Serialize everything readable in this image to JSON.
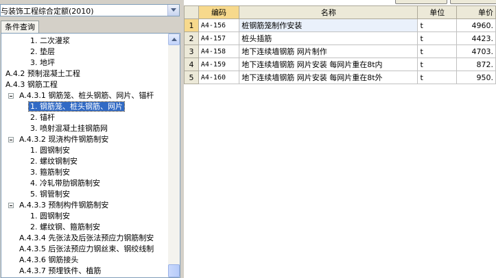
{
  "quota_selector": {
    "value": "与装饰工程综合定额(2010)"
  },
  "left_tab": {
    "label": "条件查询"
  },
  "tree": [
    {
      "label": "1. 二次灌浆",
      "level": 3
    },
    {
      "label": "2. 垫层",
      "level": 3
    },
    {
      "label": "3. 地坪",
      "level": 3
    },
    {
      "label": "A.4.2 预制混凝土工程",
      "level": 1
    },
    {
      "label": "A.4.3 钢筋工程",
      "level": 1
    },
    {
      "label": "A.4.3.1 钢筋笼、桩头钢筋、网片、锚杆",
      "level": 2,
      "expanded": true
    },
    {
      "label": "1. 钢筋笼、桩头钢筋、网片",
      "level": 3,
      "selected": true
    },
    {
      "label": "2. 锚杆",
      "level": 3
    },
    {
      "label": "3. 喷射混凝土挂钢筋网",
      "level": 3
    },
    {
      "label": "A.4.3.2 现浇构件钢筋制安",
      "level": 2,
      "expanded": true
    },
    {
      "label": "1. 圆钢制安",
      "level": 3
    },
    {
      "label": "2. 螺纹钢制安",
      "level": 3
    },
    {
      "label": "3. 箍筋制安",
      "level": 3
    },
    {
      "label": "4. 冷轧带肋钢筋制安",
      "level": 3
    },
    {
      "label": "5. 钢管制安",
      "level": 3
    },
    {
      "label": "A.4.3.3 预制构件钢筋制安",
      "level": 2,
      "expanded": true
    },
    {
      "label": "1. 圆钢制安",
      "level": 3
    },
    {
      "label": "2. 螺纹钢、箍筋制安",
      "level": 3
    },
    {
      "label": "A.4.3.4 先张法及后张法预应力钢筋制安",
      "level": 2
    },
    {
      "label": "A.4.3.5 后张法预应力钢丝束、钢绞线制",
      "level": 2
    },
    {
      "label": "A.4.3.6 钢筋接头",
      "level": 2
    },
    {
      "label": "A.4.3.7 预埋铁件、植筋",
      "level": 2
    }
  ],
  "grid": {
    "columns": [
      "编码",
      "名称",
      "单位",
      "单价"
    ],
    "rows": [
      {
        "n": "1",
        "code": "A4-156",
        "name": "桩钢筋笼制作安装",
        "unit": "t",
        "price": "4960."
      },
      {
        "n": "2",
        "code": "A4-157",
        "name": "桩头插筋",
        "unit": "t",
        "price": "4423."
      },
      {
        "n": "3",
        "code": "A4-158",
        "name": "地下连续墙钢筋 网片制作",
        "unit": "t",
        "price": "4703."
      },
      {
        "n": "4",
        "code": "A4-159",
        "name": "地下连续墙钢筋 网片安装 每网片重在8t内",
        "unit": "t",
        "price": "872."
      },
      {
        "n": "5",
        "code": "A4-160",
        "name": "地下连续墙钢筋 网片安装 每网片重在8t外",
        "unit": "t",
        "price": "950."
      }
    ]
  }
}
